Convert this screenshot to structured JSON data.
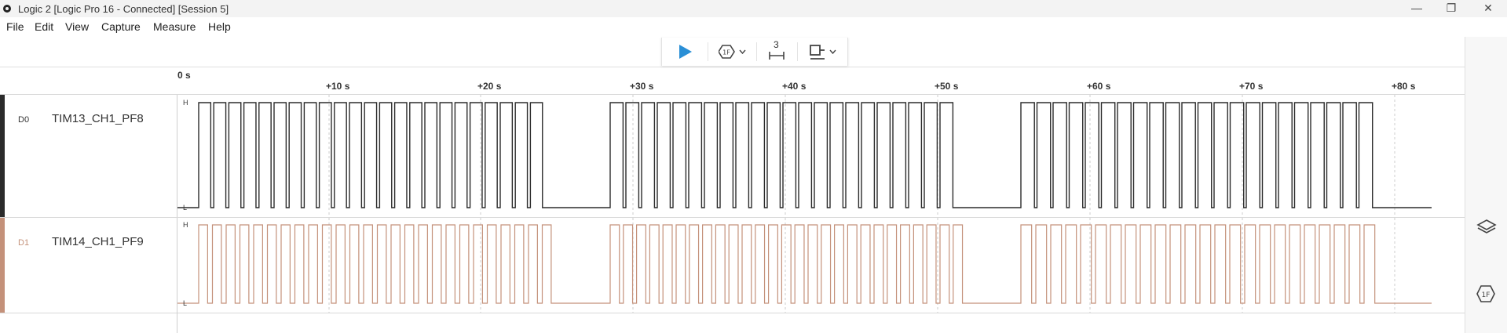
{
  "window": {
    "title": "Logic 2 [Logic Pro 16 - Connected] [Session 5]",
    "minimize_glyph": "—",
    "restore_glyph": "❐",
    "close_glyph": "✕"
  },
  "menu": {
    "items": [
      "File",
      "Edit",
      "View",
      "Capture",
      "Measure",
      "Help"
    ]
  },
  "toolbar": {
    "play_icon": "play-icon",
    "trigger_icon": "trigger-icon",
    "measure_icon": "measure-icon",
    "measure_count": "3",
    "annotation_icon": "annotation-icon",
    "colors": {
      "play": "#2a8fd6"
    }
  },
  "ruler": {
    "origin_label": "0 s",
    "tick_labels": [
      "+10 s",
      "+20 s",
      "+30 s",
      "+40 s",
      "+50 s",
      "+60 s",
      "+70 s",
      "+80 s"
    ]
  },
  "channels": [
    {
      "id": "D0",
      "name": "TIM13_CH1_PF8",
      "high_label": "H",
      "low_label": "L",
      "color": "#2b2b2b"
    },
    {
      "id": "D1",
      "name": "TIM14_CH1_PF9",
      "high_label": "H",
      "low_label": "L",
      "color": "#c4917a"
    }
  ],
  "sidebar": {
    "icons": [
      "layers-icon",
      "trigger-settings-icon"
    ]
  }
}
